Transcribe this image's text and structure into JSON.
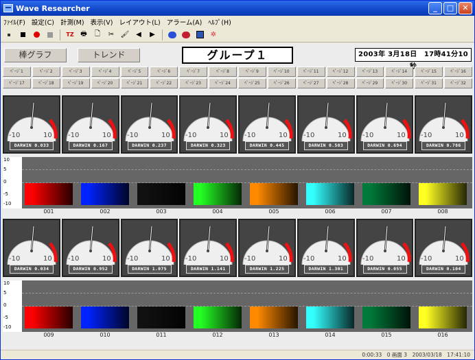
{
  "window": {
    "title": "Wave Researcher"
  },
  "menu": [
    "ﾌｧｲﾙ(F)",
    "設定(C)",
    "計測(M)",
    "表示(V)",
    "レイアウト(L)",
    "アラーム(A)",
    "ﾍﾙﾌﾟ(H)"
  ],
  "modes": {
    "bar": "棒グラフ",
    "trend": "トレンド"
  },
  "group_title": "グループ１",
  "datetime": "2003年 3月18日　17時41分10秒",
  "page_tabs": [
    "ﾍﾟｰｼﾞ1",
    "ﾍﾟｰｼﾞ2",
    "ﾍﾟｰｼﾞ3",
    "ﾍﾟｰｼﾞ4",
    "ﾍﾟｰｼﾞ5",
    "ﾍﾟｰｼﾞ6",
    "ﾍﾟｰｼﾞ7",
    "ﾍﾟｰｼﾞ8",
    "ﾍﾟｰｼﾞ9",
    "ﾍﾟｰｼﾞ10",
    "ﾍﾟｰｼﾞ11",
    "ﾍﾟｰｼﾞ12",
    "ﾍﾟｰｼﾞ13",
    "ﾍﾟｰｼﾞ14",
    "ﾍﾟｰｼﾞ15",
    "ﾍﾟｰｼﾞ16",
    "ﾍﾟｰｼﾞ17",
    "ﾍﾟｰｼﾞ18",
    "ﾍﾟｰｼﾞ19",
    "ﾍﾟｰｼﾞ20",
    "ﾍﾟｰｼﾞ21",
    "ﾍﾟｰｼﾞ22",
    "ﾍﾟｰｼﾞ23",
    "ﾍﾟｰｼﾞ24",
    "ﾍﾟｰｼﾞ25",
    "ﾍﾟｰｼﾞ26",
    "ﾍﾟｰｼﾞ27",
    "ﾍﾟｰｼﾞ28",
    "ﾍﾟｰｼﾞ29",
    "ﾍﾟｰｼﾞ30",
    "ﾍﾟｰｼﾞ31",
    "ﾍﾟｰｼﾞ32"
  ],
  "gauge_scale": {
    "top": "0",
    "left_mid": "-5",
    "right_mid": "5",
    "left_low": "-10",
    "right_low": "10"
  },
  "gauges_row1": [
    "DARWIN 0.033",
    "DARWIN 0.167",
    "DARWIN 0.237",
    "DARWIN 0.323",
    "DARWIN 0.445",
    "DARWIN 0.503",
    "DARWIN 0.694",
    "DARWIN 0.786"
  ],
  "gauges_row2": [
    "DARWIN 0.034",
    "DARWIN 0.952",
    "DARWIN 1.075",
    "DARWIN 1.141",
    "DARWIN 1.225",
    "DARWIN 1.301",
    "DARWIN 0.055",
    "DARWIN 0.104"
  ],
  "bar_scale": [
    "10",
    "5",
    "0",
    "-5",
    "-10"
  ],
  "bars_row1": [
    {
      "label": "001",
      "color": "#ff0000"
    },
    {
      "label": "002",
      "color": "#0022ff"
    },
    {
      "label": "003",
      "color": "#111111"
    },
    {
      "label": "004",
      "color": "#22ff22"
    },
    {
      "label": "005",
      "color": "#ff8a00"
    },
    {
      "label": "006",
      "color": "#33ffff"
    },
    {
      "label": "007",
      "color": "#007a3a"
    },
    {
      "label": "008",
      "color": "#ffff22"
    }
  ],
  "bars_row2": [
    {
      "label": "009",
      "color": "#ff0000"
    },
    {
      "label": "010",
      "color": "#0022ff"
    },
    {
      "label": "011",
      "color": "#111111"
    },
    {
      "label": "012",
      "color": "#22ff22"
    },
    {
      "label": "013",
      "color": "#ff8a00"
    },
    {
      "label": "014",
      "color": "#33ffff"
    },
    {
      "label": "015",
      "color": "#007a3a"
    },
    {
      "label": "016",
      "color": "#ffff22"
    }
  ],
  "status": "0:00:33　0 画面 3　2003/03/18　17:41:10"
}
